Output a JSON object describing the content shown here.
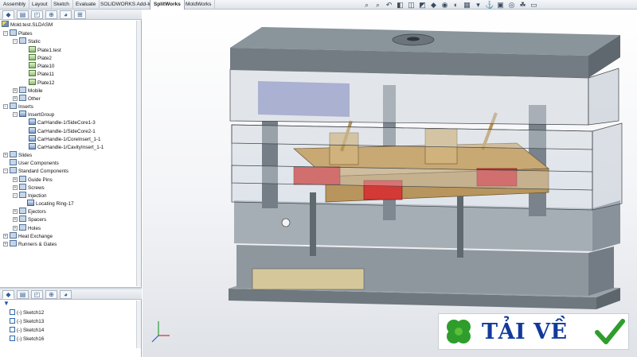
{
  "tabs": [
    "Assembly",
    "Layout",
    "Sketch",
    "Evaluate",
    "SOLIDWORKS Add-Ins",
    "SplitWorks",
    "MoldWorks"
  ],
  "active_tab": "SplitWorks",
  "tree": {
    "root": "Mold.test.SLDASM",
    "nodes": {
      "plates": "Plates",
      "static": "Static",
      "plate1": "Plate1.test",
      "plate2": "Plate2",
      "plate10": "Plate10",
      "plate11": "Plate11",
      "plate12": "Plate12",
      "mobile": "Mobile",
      "other": "Other",
      "inserts": "Inserts",
      "insertgroup": "InsertGroup",
      "sidecore3": "CarHandle-1/SideCore1-3",
      "sidecore1": "CarHandle-1/SideCore2-1",
      "coreinsert": "CarHandle-1/CoreInsert_1-1",
      "cavityinsert": "CarHandle-1/CavityInsert_1-1",
      "slides": "Slides",
      "user_components": "User Components",
      "standard_components": "Standard Components",
      "guide_pins": "Guide Pins",
      "screws": "Screws",
      "injection": "Injection",
      "locating_ring": "Locating Ring-17",
      "ejectors": "Ejectors",
      "spacers": "Spacers",
      "holes": "Holes",
      "heat_exchange": "Heat Exchange",
      "runners_gates": "Runners & Gates"
    }
  },
  "sketch_list": [
    "(-) Sketch12",
    "(-) Sketch13",
    "(-) Sketch14",
    "(-) Sketch16"
  ],
  "badge": {
    "text": "TẢI VỀ"
  },
  "colors": {
    "plate_gray": "#8a949b",
    "glass": "#c9d3dc",
    "insert_tan": "#c8a873",
    "slide_red": "#c9302c",
    "pillar": "#707a82",
    "badge_green": "#2e9d2c",
    "badge_blue": "#123a9c"
  }
}
